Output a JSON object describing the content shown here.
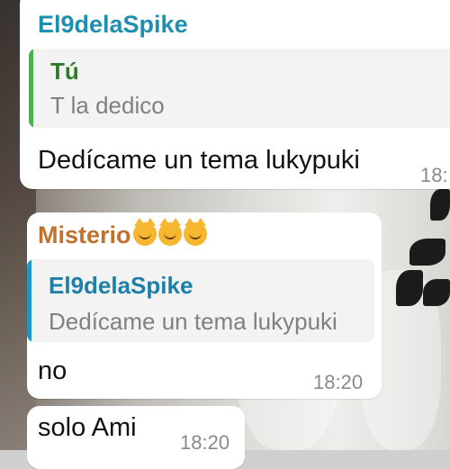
{
  "messages": [
    {
      "sender": "El9delaSpike",
      "reply": {
        "name": "Tú",
        "text": "T la dedico"
      },
      "text": "Dedícame un tema lukypuki",
      "time": "18:"
    },
    {
      "sender": "Misterio",
      "sender_emojis": [
        "kissing-cat-icon",
        "pouting-cat-icon",
        "smiling-cat-icon"
      ],
      "reply": {
        "name": "El9delaSpike",
        "text": "Dedícame un tema lukypuki"
      },
      "text": "no",
      "time": "18:20"
    },
    {
      "text": "solo Ami",
      "time": "18:20"
    }
  ],
  "colors": {
    "sender1": "#1e8fb0",
    "sender2": "#c0722c",
    "reply1_name": "#2e7a2a",
    "reply1_bar": "#4caf50",
    "reply2_name": "#1e7fa8",
    "reply2_bar": "#2196c4"
  }
}
